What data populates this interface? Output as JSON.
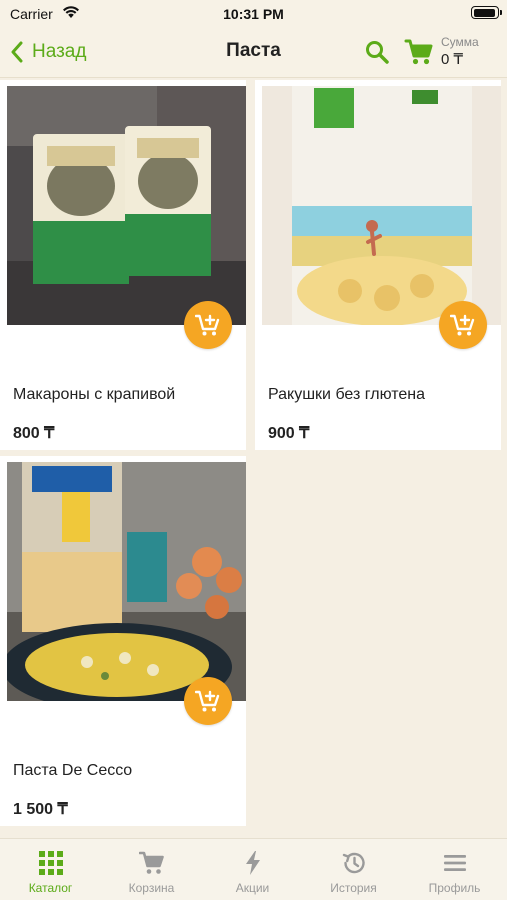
{
  "status_bar": {
    "carrier": "Carrier",
    "time": "10:31 PM",
    "battery_level": 0.85
  },
  "nav": {
    "back_label": "Назад",
    "title": "Паста",
    "sum_label": "Сумма",
    "sum_value": "0 ₸"
  },
  "products": [
    {
      "name": "Макароны с крапивой",
      "price": "800 ₸"
    },
    {
      "name": "Ракушки без глютена",
      "price": "900 ₸"
    },
    {
      "name": "Паста De Cecco",
      "price": "1 500 ₸"
    }
  ],
  "tabs": [
    {
      "label": "Каталог",
      "icon": "grid-icon",
      "active": true
    },
    {
      "label": "Корзина",
      "icon": "cart-icon",
      "active": false
    },
    {
      "label": "Акции",
      "icon": "lightning-icon",
      "active": false
    },
    {
      "label": "История",
      "icon": "history-icon",
      "active": false
    },
    {
      "label": "Профиль",
      "icon": "menu-icon",
      "active": false
    }
  ],
  "colors": {
    "accent": "#5cab19",
    "add_button": "#f5a623",
    "background": "#f5efe3"
  }
}
